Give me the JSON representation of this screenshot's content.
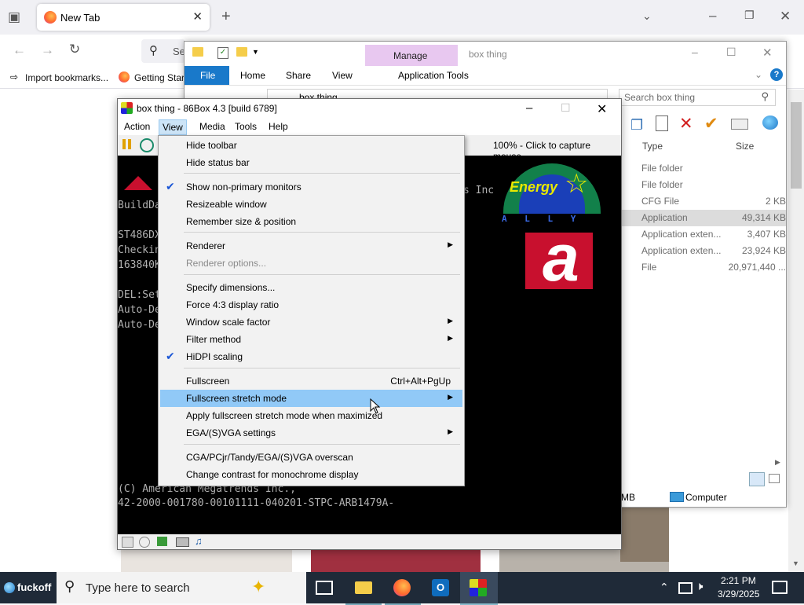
{
  "firefox": {
    "tab_title": "New Tab",
    "search_placeholder": "Se",
    "bookmarks": [
      "Import bookmarks...",
      "Getting Star"
    ]
  },
  "explorer": {
    "title": "box thing",
    "manage_label": "Manage",
    "ribbon_tabs": [
      "File",
      "Home",
      "Share",
      "View",
      "Application Tools"
    ],
    "address_text": "box thing",
    "search_placeholder": "Search box thing",
    "columns": {
      "type": "Type",
      "size": "Size"
    },
    "rows": [
      {
        "type": "File folder",
        "size": ""
      },
      {
        "type": "File folder",
        "size": ""
      },
      {
        "type": "CFG File",
        "size": "2 KB"
      },
      {
        "type": "Application",
        "size": "49,314 KB"
      },
      {
        "type": "Application exten...",
        "size": "3,407 KB"
      },
      {
        "type": "Application exten...",
        "size": "23,924 KB"
      },
      {
        "type": "File",
        "size": "20,971,440 ..."
      }
    ],
    "status_left": "MB",
    "status_computer": "Computer"
  },
  "box86": {
    "title": "box thing - 86Box 4.3 [build 6789]",
    "menus": [
      "Action",
      "View",
      "Media",
      "Tools",
      "Help"
    ],
    "capture_text": "100% - Click to capture mouse",
    "bios_lines": [
      "BuildDa",
      "ST486DX",
      "Checkin",
      "163840K",
      "DEL:Set",
      "Auto-De",
      "Auto-De"
    ],
    "bios_vendor_tail": "s Inc",
    "bios_copyright": "(C) American Megatrends Inc.,",
    "bios_id": "42-2000-001780-00101111-040201-STPC-ARB1479A-",
    "energy_word": "Energy",
    "energy_ally": "A L L Y",
    "award_letter": "a"
  },
  "view_menu": {
    "items": [
      {
        "label": "Hide toolbar"
      },
      {
        "label": "Hide status bar"
      },
      {
        "label": "Show non-primary monitors",
        "checked": true
      },
      {
        "label": "Resizeable window"
      },
      {
        "label": "Remember size & position"
      },
      {
        "label": "Renderer",
        "submenu": true
      },
      {
        "label": "Renderer options...",
        "disabled": true
      },
      {
        "label": "Specify dimensions..."
      },
      {
        "label": "Force 4:3 display ratio"
      },
      {
        "label": "Window scale factor",
        "submenu": true
      },
      {
        "label": "Filter method",
        "submenu": true
      },
      {
        "label": "HiDPI scaling",
        "checked": true
      },
      {
        "label": "Fullscreen",
        "shortcut": "Ctrl+Alt+PgUp"
      },
      {
        "label": "Fullscreen stretch mode",
        "submenu": true,
        "highlighted": true
      },
      {
        "label": "Apply fullscreen stretch mode when maximized"
      },
      {
        "label": "EGA/(S)VGA settings",
        "submenu": true
      },
      {
        "label": "CGA/PCjr/Tandy/EGA/(S)VGA overscan"
      },
      {
        "label": "Change contrast for monochrome display"
      }
    ]
  },
  "taskbar": {
    "start_label": "fuckoff",
    "search_placeholder": "Type here to search",
    "time": "2:21 PM",
    "date": "3/29/2025"
  },
  "colors": {
    "accent": "#1979ca",
    "menu_highlight": "#91c9f7",
    "manage_tab": "#e8c8f0",
    "taskbar": "#1f2a38",
    "bios_red": "#c8102e"
  }
}
